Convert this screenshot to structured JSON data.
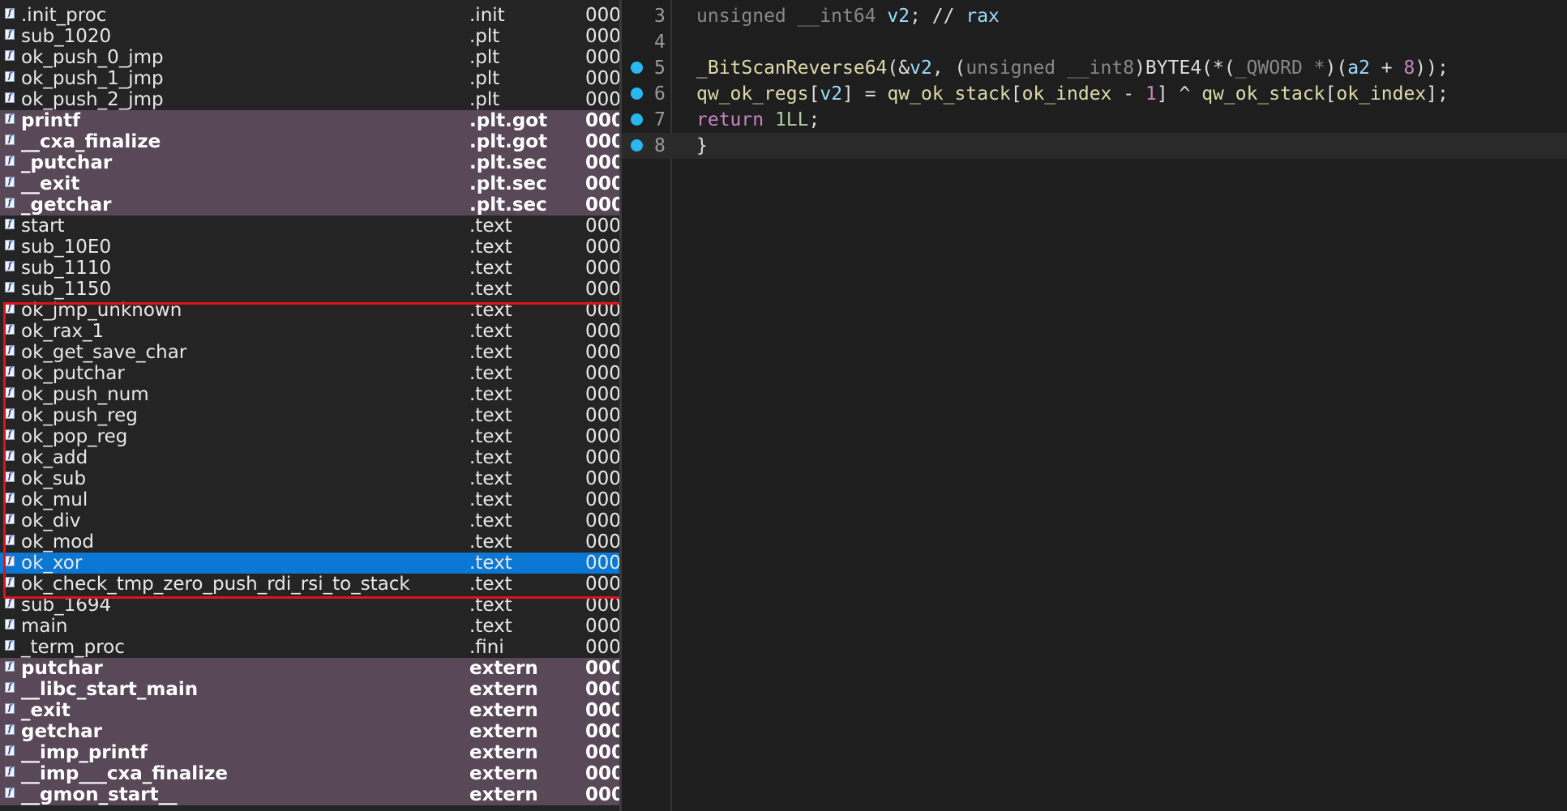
{
  "functions": [
    {
      "name": ".init_proc",
      "segment": ".init",
      "address": "000",
      "style": "normal"
    },
    {
      "name": "sub_1020",
      "segment": ".plt",
      "address": "000",
      "style": "normal"
    },
    {
      "name": "ok_push_0_jmp",
      "segment": ".plt",
      "address": "000",
      "style": "normal"
    },
    {
      "name": "ok_push_1_jmp",
      "segment": ".plt",
      "address": "000",
      "style": "normal"
    },
    {
      "name": "ok_push_2_jmp",
      "segment": ".plt",
      "address": "000",
      "style": "normal"
    },
    {
      "name": "printf",
      "segment": ".plt.got",
      "address": "000",
      "style": "import"
    },
    {
      "name": "__cxa_finalize",
      "segment": ".plt.got",
      "address": "000",
      "style": "import"
    },
    {
      "name": "_putchar",
      "segment": ".plt.sec",
      "address": "000",
      "style": "import"
    },
    {
      "name": "__exit",
      "segment": ".plt.sec",
      "address": "000",
      "style": "import"
    },
    {
      "name": "_getchar",
      "segment": ".plt.sec",
      "address": "000",
      "style": "import"
    },
    {
      "name": "start",
      "segment": ".text",
      "address": "000",
      "style": "normal"
    },
    {
      "name": "sub_10E0",
      "segment": ".text",
      "address": "000",
      "style": "normal"
    },
    {
      "name": "sub_1110",
      "segment": ".text",
      "address": "000",
      "style": "normal"
    },
    {
      "name": "sub_1150",
      "segment": ".text",
      "address": "000",
      "style": "normal"
    },
    {
      "name": "ok_jmp_unknown",
      "segment": ".text",
      "address": "000",
      "style": "normal"
    },
    {
      "name": "ok_rax_1",
      "segment": ".text",
      "address": "000",
      "style": "normal"
    },
    {
      "name": "ok_get_save_char",
      "segment": ".text",
      "address": "000",
      "style": "normal"
    },
    {
      "name": "ok_putchar",
      "segment": ".text",
      "address": "000",
      "style": "normal"
    },
    {
      "name": "ok_push_num",
      "segment": ".text",
      "address": "000",
      "style": "normal"
    },
    {
      "name": "ok_push_reg",
      "segment": ".text",
      "address": "000",
      "style": "normal"
    },
    {
      "name": "ok_pop_reg",
      "segment": ".text",
      "address": "000",
      "style": "normal"
    },
    {
      "name": "ok_add",
      "segment": ".text",
      "address": "000",
      "style": "normal"
    },
    {
      "name": "ok_sub",
      "segment": ".text",
      "address": "000",
      "style": "normal"
    },
    {
      "name": "ok_mul",
      "segment": ".text",
      "address": "000",
      "style": "normal"
    },
    {
      "name": "ok_div",
      "segment": ".text",
      "address": "000",
      "style": "normal"
    },
    {
      "name": "ok_mod",
      "segment": ".text",
      "address": "000",
      "style": "normal"
    },
    {
      "name": "ok_xor",
      "segment": ".text",
      "address": "000",
      "style": "selected"
    },
    {
      "name": "ok_check_tmp_zero_push_rdi_rsi_to_stack",
      "segment": ".text",
      "address": "000",
      "style": "normal"
    },
    {
      "name": "sub_1694",
      "segment": ".text",
      "address": "000",
      "style": "normal"
    },
    {
      "name": "main",
      "segment": ".text",
      "address": "000",
      "style": "normal"
    },
    {
      "name": "_term_proc",
      "segment": ".fini",
      "address": "000",
      "style": "normal"
    },
    {
      "name": "putchar",
      "segment": "extern",
      "address": "000",
      "style": "import"
    },
    {
      "name": "__libc_start_main",
      "segment": "extern",
      "address": "000",
      "style": "import"
    },
    {
      "name": "_exit",
      "segment": "extern",
      "address": "000",
      "style": "import"
    },
    {
      "name": "getchar",
      "segment": "extern",
      "address": "000",
      "style": "import"
    },
    {
      "name": "__imp_printf",
      "segment": "extern",
      "address": "000",
      "style": "import"
    },
    {
      "name": "__imp___cxa_finalize",
      "segment": "extern",
      "address": "000",
      "style": "import"
    },
    {
      "name": "__gmon_start__",
      "segment": "extern",
      "address": "000",
      "style": "import"
    }
  ],
  "code": {
    "lines": [
      {
        "num": "3",
        "breakpoint": false,
        "tokens": [
          [
            "typ",
            "unsigned __int64 "
          ],
          [
            "var",
            "v2"
          ],
          [
            "cmt",
            "; // "
          ],
          [
            "var",
            "rax"
          ]
        ]
      },
      {
        "num": "4",
        "breakpoint": false,
        "tokens": []
      },
      {
        "num": "5",
        "breakpoint": true,
        "tokens": [
          [
            "fn",
            "_BitScanReverse64"
          ],
          [
            "cmt",
            "(&"
          ],
          [
            "var",
            "v2"
          ],
          [
            "cmt",
            ", ("
          ],
          [
            "typ",
            "unsigned __int8"
          ],
          [
            "cmt",
            ")BYTE4(*("
          ],
          [
            "typ",
            "_QWORD *"
          ],
          [
            "cmt",
            ")("
          ],
          [
            "var",
            "a2"
          ],
          [
            "cmt",
            " + "
          ],
          [
            "ret",
            "8"
          ],
          [
            "cmt",
            "));"
          ]
        ]
      },
      {
        "num": "6",
        "breakpoint": true,
        "tokens": [
          [
            "glob",
            "qw_ok_regs"
          ],
          [
            "cmt",
            "["
          ],
          [
            "var",
            "v2"
          ],
          [
            "cmt",
            "] = "
          ],
          [
            "glob",
            "qw_ok_stack"
          ],
          [
            "cmt",
            "["
          ],
          [
            "glob",
            "ok_index"
          ],
          [
            "cmt",
            " - "
          ],
          [
            "ret",
            "1"
          ],
          [
            "cmt",
            "] ^ "
          ],
          [
            "glob",
            "qw_ok_stack"
          ],
          [
            "cmt",
            "["
          ],
          [
            "glob",
            "ok_index"
          ],
          [
            "cmt",
            "];"
          ]
        ]
      },
      {
        "num": "7",
        "breakpoint": true,
        "tokens": [
          [
            "ret",
            "return "
          ],
          [
            "num",
            "1LL"
          ],
          [
            "cmt",
            ";"
          ]
        ]
      },
      {
        "num": "8",
        "breakpoint": true,
        "tokens": [
          [
            "cmt",
            "}"
          ]
        ]
      }
    ]
  },
  "icon_glyph": "f",
  "colors": {
    "import_row_bg": "#584858",
    "selected_row_bg": "#0a78d4",
    "highlight_border": "#e0121b",
    "breakpoint": "#27b8f0"
  }
}
